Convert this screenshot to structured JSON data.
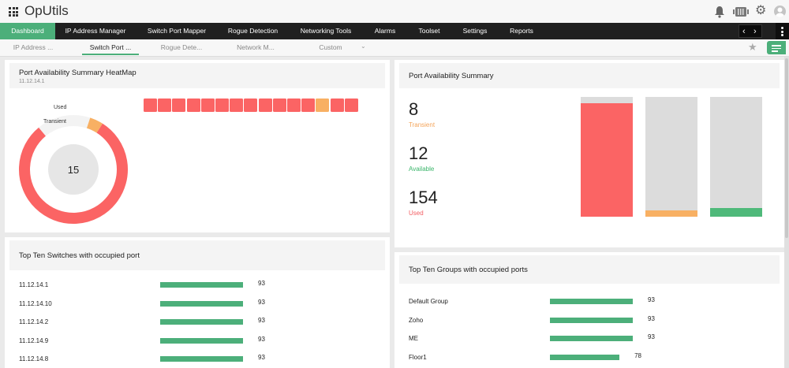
{
  "app": {
    "title": "OpUtils"
  },
  "icons": {
    "apps": "apps-grid-icon",
    "bell": "bell-icon",
    "server": "server-icon",
    "settings": "gear-icon",
    "user": "user-avatar-icon",
    "star": "star-icon",
    "menu": "more-vertical-icon"
  },
  "nav": {
    "items": [
      {
        "label": "Dashboard",
        "active": true
      },
      {
        "label": "IP Address Manager"
      },
      {
        "label": "Switch Port Mapper"
      },
      {
        "label": "Rogue Detection"
      },
      {
        "label": "Networking Tools"
      },
      {
        "label": "Alarms"
      },
      {
        "label": "Toolset"
      },
      {
        "label": "Settings"
      },
      {
        "label": "Reports"
      }
    ]
  },
  "subtabs": [
    {
      "label": "IP Address ..."
    },
    {
      "label": "Switch Port ...",
      "active": true
    },
    {
      "label": "Rogue Dete..."
    },
    {
      "label": "Network M..."
    },
    {
      "label": "Custom"
    }
  ],
  "heatmap": {
    "title": "Port Availability Summary HeatMap",
    "subtitle": "11.12.14.1",
    "donut_center": "15",
    "label_used": "Used",
    "label_transient": "Transient",
    "donut_used_fraction": 0.8,
    "donut_transient_fraction": 0.04,
    "cells": [
      "used",
      "used",
      "used",
      "used",
      "used",
      "used",
      "used",
      "used",
      "used",
      "used",
      "used",
      "used",
      "transient",
      "used",
      "used"
    ]
  },
  "summary": {
    "title": "Port Availability Summary",
    "stats": [
      {
        "value": "8",
        "label": "Transient",
        "color": "#f4a55b"
      },
      {
        "value": "12",
        "label": "Available",
        "color": "#3ab56a"
      },
      {
        "value": "154",
        "label": "Used",
        "color": "#f25e63"
      }
    ],
    "bars": [
      {
        "name": "Used",
        "fraction": 0.95,
        "color": "#fb6464"
      },
      {
        "name": "Transient",
        "fraction": 0.05,
        "color": "#f8b063"
      },
      {
        "name": "Available",
        "fraction": 0.07,
        "color": "#4fb97a"
      }
    ]
  },
  "top_switches": {
    "title": "Top Ten Switches with occupied port",
    "rows": [
      {
        "name": "11.12.14.1",
        "value": "93",
        "pct": 93
      },
      {
        "name": "11.12.14.10",
        "value": "93",
        "pct": 93
      },
      {
        "name": "11.12.14.2",
        "value": "93",
        "pct": 93
      },
      {
        "name": "11.12.14.9",
        "value": "93",
        "pct": 93
      },
      {
        "name": "11.12.14.8",
        "value": "93",
        "pct": 93
      }
    ]
  },
  "top_groups": {
    "title": "Top Ten Groups with occupied ports",
    "rows": [
      {
        "name": "Default Group",
        "value": "93",
        "pct": 93
      },
      {
        "name": "Zoho",
        "value": "93",
        "pct": 93
      },
      {
        "name": "ME",
        "value": "93",
        "pct": 93
      },
      {
        "name": "Floor1",
        "value": "78",
        "pct": 78
      }
    ]
  },
  "colors": {
    "accent": "#4caf7a",
    "used": "#fb6464",
    "transient": "#f8b063",
    "available": "#4fb97a"
  }
}
